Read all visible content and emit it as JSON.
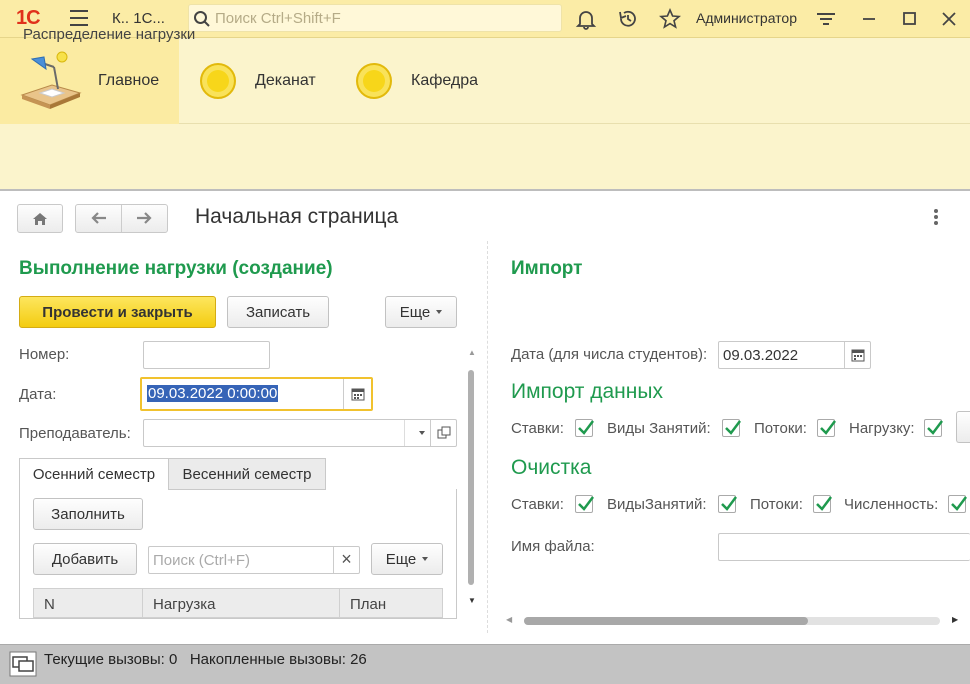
{
  "app": {
    "logo": "1С",
    "title": "К.. 1С...",
    "search_placeholder": "Поиск Ctrl+Shift+F",
    "user": "Администратор"
  },
  "sections": [
    {
      "label": "Главное",
      "icon": "desk-lamp-icon"
    },
    {
      "label": "Деканат",
      "icon": "coin-icon"
    },
    {
      "label": "Кафедра",
      "icon": "coin-icon"
    }
  ],
  "subsection": {
    "item": "Распределение нагрузки"
  },
  "page": {
    "title": "Начальная страница"
  },
  "doc": {
    "title": "Выполнение нагрузки (создание)",
    "post_close": "Провести и закрыть",
    "save": "Записать",
    "more": "Еще",
    "number_label": "Номер:",
    "number_value": "",
    "date_label": "Дата:",
    "date_value": "09.03.2022  0:00:00",
    "teacher_label": "Преподаватель:",
    "teacher_value": "",
    "tabs": [
      "Осенний семестр",
      "Весенний семестр"
    ],
    "fill": "Заполнить",
    "add": "Добавить",
    "search_placeholder": "Поиск (Ctrl+F)",
    "clear": "×",
    "more2": "Еще",
    "columns": [
      "N",
      "Нагрузка",
      "План"
    ]
  },
  "import": {
    "title": "Импорт",
    "date_label": "Дата (для числа студентов):",
    "date_value": "09.03.2022",
    "data_title": "Импорт данных",
    "data_checks": [
      {
        "label": "Ставки:",
        "checked": true
      },
      {
        "label": "Виды Занятий:",
        "checked": true
      },
      {
        "label": "Потоки:",
        "checked": true
      },
      {
        "label": "Нагрузку:",
        "checked": true
      }
    ],
    "clean_title": "Очистка",
    "clean_checks": [
      {
        "label": "Ставки:",
        "checked": true
      },
      {
        "label": "ВидыЗанятий:",
        "checked": true
      },
      {
        "label": "Потоки:",
        "checked": true
      },
      {
        "label": "Численность:",
        "checked": true
      }
    ],
    "file_label": "Имя файла:",
    "file_value": ""
  },
  "status": {
    "text": "Текущие вызовы: 0   Накопленные вызовы: 26"
  },
  "colors": {
    "accent": "#1f9a4e",
    "primary_btn": "#f3cc10",
    "topbar": "#fbeca6",
    "logo": "#e0311b"
  }
}
